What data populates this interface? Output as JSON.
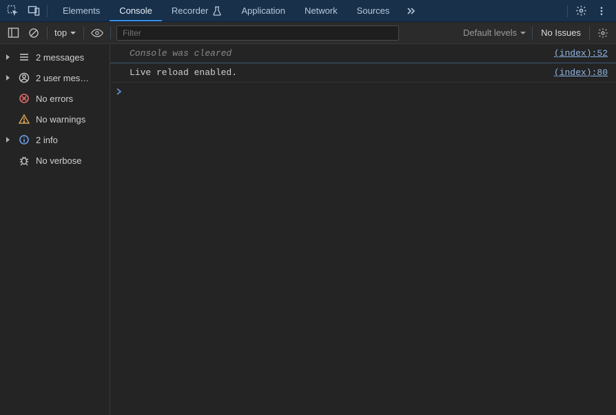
{
  "tabbar": {
    "tabs": [
      {
        "label": "Elements",
        "active": false
      },
      {
        "label": "Console",
        "active": true
      },
      {
        "label": "Recorder",
        "active": false,
        "beaker": true
      },
      {
        "label": "Application",
        "active": false
      },
      {
        "label": "Network",
        "active": false
      },
      {
        "label": "Sources",
        "active": false
      }
    ]
  },
  "toolbar": {
    "context_label": "top",
    "filter_placeholder": "Filter",
    "levels_label": "Default levels",
    "no_issues_label": "No Issues"
  },
  "sidebar": {
    "items": [
      {
        "kind": "messages",
        "label": "2 messages",
        "expandable": true
      },
      {
        "kind": "user",
        "label": "2 user mes…",
        "expandable": true
      },
      {
        "kind": "errors",
        "label": "No errors",
        "expandable": false
      },
      {
        "kind": "warnings",
        "label": "No warnings",
        "expandable": false
      },
      {
        "kind": "info",
        "label": "2 info",
        "expandable": true
      },
      {
        "kind": "verbose",
        "label": "No verbose",
        "expandable": false
      }
    ]
  },
  "console": {
    "rows": [
      {
        "type": "cleared",
        "text": "Console was cleared",
        "source": "(index):52"
      },
      {
        "type": "log",
        "text": "Live reload enabled.",
        "source": "(index):80"
      }
    ]
  }
}
